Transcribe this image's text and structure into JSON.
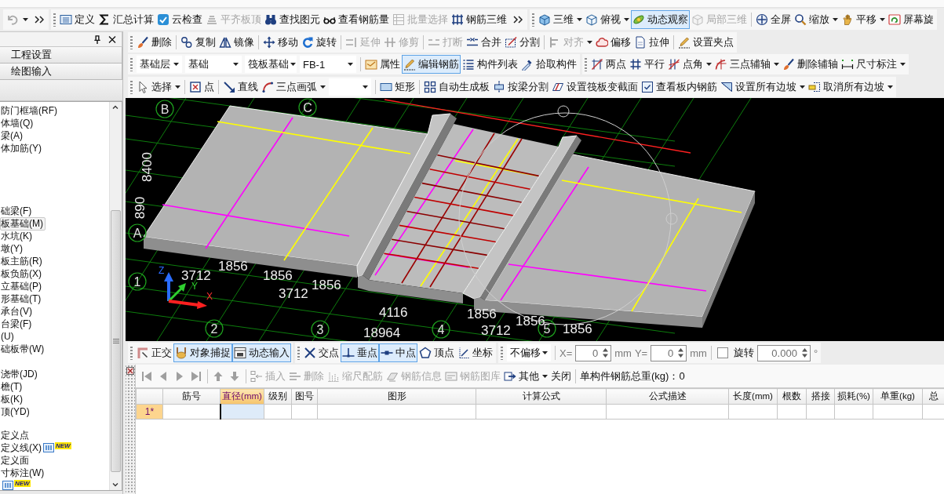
{
  "top_toolbars": [
    {
      "overflow": true,
      "groups": [
        [
          {
            "kind": "menu",
            "disabled": true,
            "active": false
          }
        ]
      ]
    },
    {
      "overflow": true,
      "groups": [
        [
          {
            "kind": "button",
            "label": "定义",
            "disabled": false,
            "active": false
          },
          {
            "kind": "button",
            "label": "汇总计算",
            "disabled": false,
            "active": false
          },
          {
            "kind": "button",
            "label": "云检查",
            "disabled": false,
            "active": false
          },
          {
            "kind": "button",
            "label": "平齐板顶",
            "disabled": true,
            "active": false
          },
          {
            "kind": "button",
            "label": "查找图元",
            "disabled": false,
            "active": false
          },
          {
            "kind": "button",
            "label": "查看钢筋量",
            "disabled": false,
            "active": false
          },
          {
            "kind": "button",
            "label": "批量选择",
            "disabled": true,
            "active": false
          },
          {
            "kind": "button",
            "label": "钢筋三维",
            "disabled": false,
            "active": false
          }
        ]
      ]
    },
    {
      "overflow": false,
      "groups": [
        [
          {
            "kind": "menu",
            "label": "三维",
            "disabled": false,
            "active": false
          },
          {
            "kind": "menu",
            "label": "俯视",
            "disabled": false,
            "active": false
          },
          {
            "kind": "button",
            "label": "动态观察",
            "disabled": false,
            "active": true
          },
          {
            "kind": "button",
            "label": "局部三维",
            "disabled": true,
            "active": false
          }
        ],
        [
          {
            "kind": "button",
            "label": "全屏",
            "disabled": false,
            "active": false
          },
          {
            "kind": "menu",
            "label": "缩放",
            "disabled": false,
            "active": false
          },
          {
            "kind": "menu",
            "label": "平移",
            "disabled": false,
            "active": false
          },
          {
            "kind": "button",
            "label": "屏幕旋",
            "disabled": false,
            "active": false
          }
        ]
      ]
    }
  ],
  "left_panel": {
    "nav_buttons": [
      "工程设置",
      "绘图输入"
    ],
    "tree": {
      "groups": [
        [
          {
            "label": "防门框墙(RF)",
            "selected": false
          },
          {
            "label": "体墙(Q)",
            "selected": false
          },
          {
            "label": "梁(A)",
            "selected": false
          },
          {
            "label": "体加筋(Y)",
            "selected": false
          }
        ],
        [
          {
            "label": "础梁(F)",
            "selected": false
          },
          {
            "label": "板基础(M)",
            "selected": true
          },
          {
            "label": "水坑(K)",
            "selected": false
          },
          {
            "label": "墩(Y)",
            "selected": false
          },
          {
            "label": "板主筋(R)",
            "selected": false
          },
          {
            "label": "板负筋(X)",
            "selected": false
          },
          {
            "label": "立基础(P)",
            "selected": false
          },
          {
            "label": "形基础(T)",
            "selected": false
          },
          {
            "label": "承台(V)",
            "selected": false
          },
          {
            "label": "台梁(F)",
            "selected": false
          },
          {
            "label": "(U)",
            "selected": false
          },
          {
            "label": "础板带(W)",
            "selected": false
          }
        ],
        [
          {
            "label": "浇带(JD)",
            "selected": false
          },
          {
            "label": "檐(T)",
            "selected": false
          },
          {
            "label": "板(K)",
            "selected": false
          },
          {
            "label": "顶(YD)",
            "selected": false
          }
        ],
        [
          {
            "label": "定义点",
            "selected": false
          },
          {
            "label": "定义线(X)",
            "badge": "NEW",
            "selected": false
          },
          {
            "label": "定义面",
            "selected": false
          },
          {
            "label": "寸标注(W)",
            "selected": false
          },
          {
            "badge": "NEW",
            "selected": false
          }
        ]
      ]
    }
  },
  "edit_toolbars": [
    [
      {
        "groups": [
          [
            {
              "kind": "button",
              "label": "删除",
              "disabled": false,
              "active": false
            }
          ],
          [
            {
              "kind": "button",
              "label": "复制",
              "disabled": false,
              "active": false
            },
            {
              "kind": "button",
              "label": "镜像",
              "disabled": false,
              "active": false
            }
          ],
          [
            {
              "kind": "button",
              "label": "移动",
              "disabled": false,
              "active": false
            },
            {
              "kind": "button",
              "label": "旋转",
              "disabled": false,
              "active": false
            }
          ],
          [
            {
              "kind": "button",
              "label": "延伸",
              "disabled": true,
              "active": false
            },
            {
              "kind": "button",
              "label": "修剪",
              "disabled": true,
              "active": false
            }
          ],
          [
            {
              "kind": "button",
              "label": "打断",
              "disabled": true,
              "active": false
            },
            {
              "kind": "button",
              "label": "合并",
              "disabled": false,
              "active": false
            },
            {
              "kind": "button",
              "label": "分割",
              "disabled": false,
              "active": false
            }
          ],
          [
            {
              "kind": "menu",
              "label": "对齐",
              "disabled": true,
              "active": false
            },
            {
              "kind": "button",
              "label": "偏移",
              "disabled": false,
              "active": false
            },
            {
              "kind": "button",
              "label": "拉伸",
              "disabled": false,
              "active": false
            }
          ],
          [
            {
              "kind": "button",
              "label": "设置夹点",
              "disabled": false,
              "active": false
            }
          ]
        ]
      }
    ],
    [
      {
        "groups": [
          [
            {
              "kind": "select",
              "value": "基础层"
            },
            {
              "kind": "select",
              "value": "基础"
            },
            {
              "kind": "select",
              "value": "筏板基础"
            },
            {
              "kind": "select",
              "value": "FB-1"
            }
          ],
          [
            {
              "kind": "button",
              "label": "属性",
              "disabled": false,
              "active": false
            },
            {
              "kind": "button",
              "label": "编辑钢筋",
              "disabled": false,
              "active": true
            },
            {
              "kind": "button",
              "label": "构件列表",
              "disabled": false,
              "active": false
            },
            {
              "kind": "button",
              "label": "拾取构件",
              "disabled": false,
              "active": false
            }
          ]
        ]
      },
      {
        "groups": [
          [
            {
              "kind": "button",
              "label": "两点",
              "disabled": false,
              "active": false
            },
            {
              "kind": "button",
              "label": "平行",
              "disabled": false,
              "active": false
            },
            {
              "kind": "menu",
              "label": "点角",
              "disabled": false,
              "active": false
            },
            {
              "kind": "menu",
              "label": "三点辅轴",
              "disabled": false,
              "active": false
            },
            {
              "kind": "button",
              "label": "删除辅轴",
              "disabled": false,
              "active": false
            },
            {
              "kind": "menu",
              "label": "尺寸标注",
              "disabled": false,
              "active": false
            }
          ]
        ]
      }
    ],
    [
      {
        "groups": [
          [
            {
              "kind": "menu",
              "label": "选择",
              "disabled": false,
              "active": false
            }
          ],
          [
            {
              "kind": "button",
              "label": "点",
              "disabled": false,
              "active": false
            }
          ],
          [
            {
              "kind": "button",
              "label": "直线",
              "disabled": false,
              "active": false
            },
            {
              "kind": "menu",
              "label": "三点画弧",
              "disabled": false,
              "active": false
            },
            {
              "kind": "select"
            }
          ],
          [
            {
              "kind": "button",
              "label": "矩形",
              "disabled": false,
              "active": false
            }
          ],
          [
            {
              "kind": "button",
              "label": "自动生成板",
              "disabled": false,
              "active": false
            },
            {
              "kind": "button",
              "label": "按梁分割",
              "disabled": false,
              "active": false
            },
            {
              "kind": "button",
              "label": "设置筏板变截面",
              "disabled": false,
              "active": false
            },
            {
              "kind": "button",
              "label": "查看板内钢筋",
              "disabled": false,
              "active": false
            },
            {
              "kind": "menu",
              "label": "设置所有边坡",
              "disabled": false,
              "active": false
            },
            {
              "kind": "menu",
              "label": "取消所有边坡",
              "disabled": false,
              "active": false
            }
          ]
        ]
      }
    ]
  ],
  "viewport": {
    "axis_labels": [
      "B",
      "C",
      "A",
      "1",
      "2",
      "3",
      "4",
      "5"
    ],
    "dimension_labels": [
      "1856",
      "3712",
      "1856",
      "1856",
      "3712",
      "4116",
      "18964",
      "1856",
      "3712",
      "1856",
      "1856",
      "8400",
      "890"
    ],
    "gizmo_labels": [
      "Z",
      "Y",
      "X"
    ]
  },
  "snap_toolbars": [
    {
      "groups": [
        [
          {
            "kind": "button",
            "label": "正交",
            "disabled": false,
            "active": false
          },
          {
            "kind": "button",
            "label": "对象捕捉",
            "disabled": false,
            "active": true
          },
          {
            "kind": "button",
            "label": "动态输入",
            "disabled": false,
            "active": true
          }
        ]
      ]
    },
    {
      "groups": [
        [
          {
            "kind": "button",
            "label": "交点",
            "disabled": false,
            "active": false
          },
          {
            "kind": "button",
            "label": "垂点",
            "disabled": false,
            "active": true
          },
          {
            "kind": "button",
            "label": "中点",
            "disabled": false,
            "active": true
          },
          {
            "kind": "button",
            "label": "顶点",
            "disabled": false,
            "active": false
          },
          {
            "kind": "button",
            "label": "坐标",
            "disabled": false,
            "active": false
          }
        ]
      ]
    },
    {
      "groups": [
        [
          {
            "kind": "select",
            "value": "不偏移"
          }
        ],
        [
          {
            "kind": "text",
            "label": "X=",
            "disabled": true
          },
          {
            "kind": "spin",
            "value": "0",
            "disabled": true
          },
          {
            "kind": "text",
            "label": "mm",
            "disabled": true
          },
          {
            "kind": "text",
            "label": "Y=",
            "disabled": true
          },
          {
            "kind": "spin",
            "value": "0",
            "disabled": true
          },
          {
            "kind": "text",
            "label": "mm",
            "disabled": true
          }
        ],
        [
          {
            "kind": "checkbox",
            "checked": false
          },
          {
            "kind": "text",
            "label": "旋转",
            "disabled": false
          },
          {
            "kind": "spin",
            "value": "0.000",
            "disabled": true
          },
          {
            "kind": "text",
            "label": "°",
            "disabled": true
          }
        ]
      ]
    }
  ],
  "rebar_table": {
    "toolbar": {
      "groups": [
        [
          {
            "kind": "button",
            "disabled": true,
            "active": false
          },
          {
            "kind": "button",
            "disabled": true,
            "active": false
          },
          {
            "kind": "button",
            "disabled": true,
            "active": false
          },
          {
            "kind": "button",
            "disabled": true,
            "active": false
          }
        ],
        [
          {
            "kind": "button",
            "disabled": true,
            "active": false
          },
          {
            "kind": "button",
            "disabled": true,
            "active": false
          }
        ],
        [
          {
            "kind": "button",
            "label": "插入",
            "disabled": true,
            "active": false
          },
          {
            "kind": "button",
            "label": "删除",
            "disabled": true,
            "active": false
          },
          {
            "kind": "button",
            "label": "缩尺配筋",
            "disabled": true,
            "active": false
          },
          {
            "kind": "button",
            "label": "钢筋信息",
            "disabled": true,
            "active": false
          },
          {
            "kind": "button",
            "label": "钢筋图库",
            "disabled": true,
            "active": false
          },
          {
            "kind": "menu",
            "label": "其他",
            "disabled": false,
            "active": false
          },
          {
            "kind": "button",
            "label": "关闭",
            "disabled": false,
            "active": false
          }
        ],
        [
          {
            "kind": "text",
            "label": "单构件钢筋总重(kg)：0",
            "disabled": false
          }
        ]
      ]
    },
    "columns": [
      {
        "label": "筋号",
        "selected": false
      },
      {
        "label": "直径(mm)",
        "selected": true
      },
      {
        "label": "级别",
        "selected": false
      },
      {
        "label": "图号",
        "selected": false
      },
      {
        "label": "图形",
        "selected": false
      },
      {
        "label": "计算公式",
        "selected": false
      },
      {
        "label": "公式描述",
        "selected": false
      },
      {
        "label": "长度(mm)",
        "selected": false
      },
      {
        "label": "根数",
        "selected": false
      },
      {
        "label": "搭接",
        "selected": false
      },
      {
        "label": "损耗(%)",
        "selected": false
      },
      {
        "label": "单重(kg)",
        "selected": false
      },
      {
        "label": "总",
        "selected": false
      }
    ],
    "rows": [
      {
        "label": "1*",
        "selected": true
      }
    ]
  }
}
